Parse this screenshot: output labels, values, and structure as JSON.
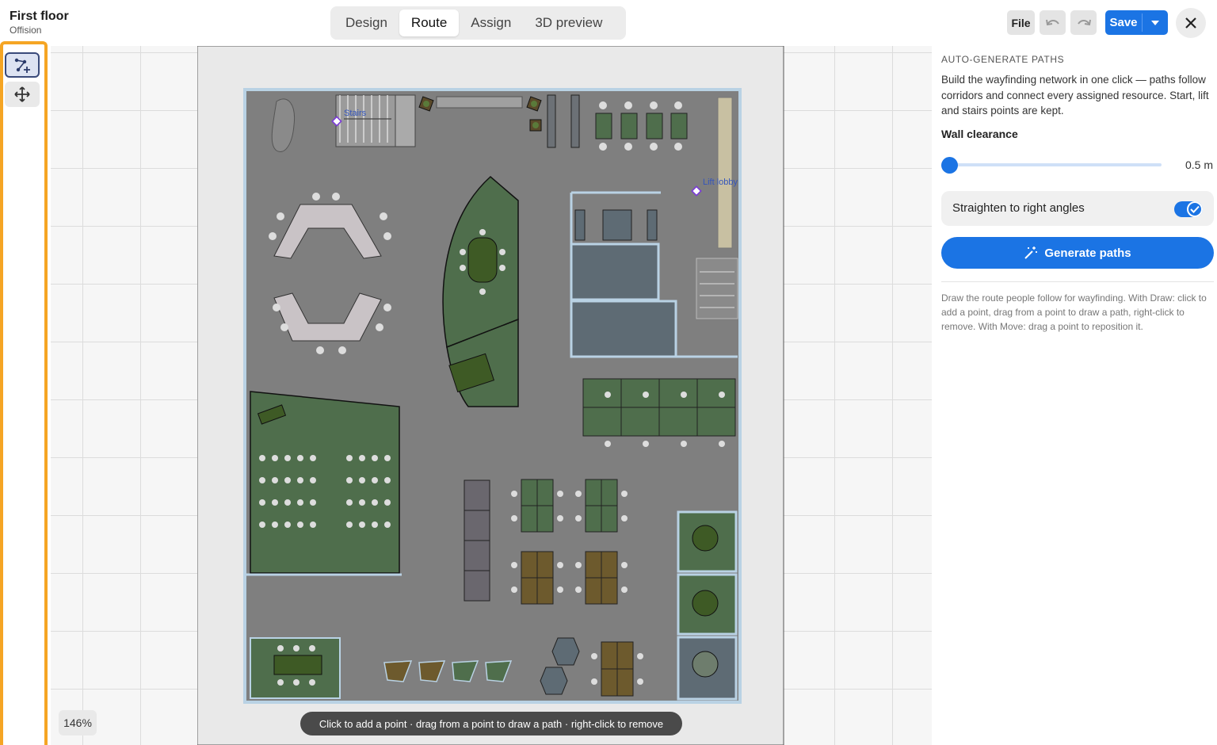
{
  "header": {
    "title": "First floor",
    "subtitle": "Offision",
    "tabs": [
      {
        "label": "Design",
        "active": false
      },
      {
        "label": "Route",
        "active": true
      },
      {
        "label": "Assign",
        "active": false
      },
      {
        "label": "3D preview",
        "active": false
      }
    ],
    "file_label": "File",
    "save_label": "Save",
    "icons": {
      "undo": "undo-icon",
      "redo": "redo-icon",
      "save_menu": "chevron-down-icon",
      "close": "close-icon"
    }
  },
  "toolbar": {
    "tools": [
      {
        "name": "draw-path-tool",
        "icon": "path-draw-icon",
        "active": true
      },
      {
        "name": "move-point-tool",
        "icon": "move-icon",
        "active": false
      }
    ],
    "accent": "#f5a524"
  },
  "canvas": {
    "zoom": "146%",
    "hint": "Click to add a point · drag from a point to draw a path · right-click to remove",
    "points": [
      {
        "label": "Stairs"
      },
      {
        "label": "Lift lobby"
      }
    ]
  },
  "panel": {
    "heading": "AUTO-GENERATE PATHS",
    "description": "Build the wayfinding network in one click — paths follow corridors and connect every assigned resource. Start, lift and stairs points are kept.",
    "clearance_label": "Wall clearance",
    "clearance_value": "0.5 m",
    "straighten_label": "Straighten to right angles",
    "straighten_enabled": true,
    "generate_label": "Generate paths",
    "help_text": "Draw the route people follow for wayfinding. With Draw: click to add a point, drag from a point to draw a path, right-click to remove. With Move: drag a point to reposition it."
  },
  "colors": {
    "primary": "#1b74e4",
    "floor": "#7d7d7d",
    "room_green": "#4f6e4c",
    "room_blue": "#5e6b74",
    "wood": "#6d5a2d"
  }
}
